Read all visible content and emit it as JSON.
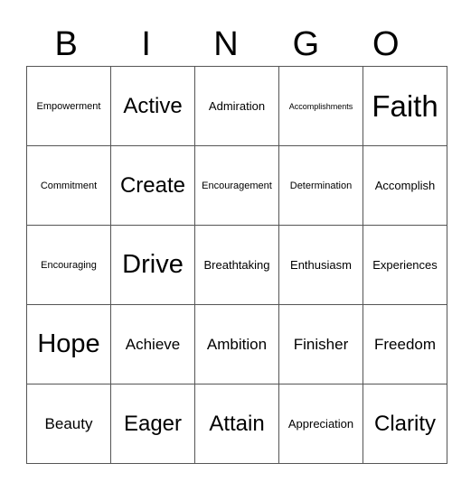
{
  "header": [
    "B",
    "I",
    "N",
    "G",
    "O"
  ],
  "rows": [
    [
      {
        "text": "Empowerment",
        "size": "s-sm"
      },
      {
        "text": "Active",
        "size": "s-xl"
      },
      {
        "text": "Admiration",
        "size": "s-md"
      },
      {
        "text": "Accomplishments",
        "size": "s-xs"
      },
      {
        "text": "Faith",
        "size": "s-max"
      }
    ],
    [
      {
        "text": "Commitment",
        "size": "s-sm"
      },
      {
        "text": "Create",
        "size": "s-xl"
      },
      {
        "text": "Encouragement",
        "size": "s-sm"
      },
      {
        "text": "Determination",
        "size": "s-sm"
      },
      {
        "text": "Accomplish",
        "size": "s-md"
      }
    ],
    [
      {
        "text": "Encouraging",
        "size": "s-sm"
      },
      {
        "text": "Drive",
        "size": "s-xxl"
      },
      {
        "text": "Breathtaking",
        "size": "s-md"
      },
      {
        "text": "Enthusiasm",
        "size": "s-md"
      },
      {
        "text": "Experiences",
        "size": "s-md"
      }
    ],
    [
      {
        "text": "Hope",
        "size": "s-xxl"
      },
      {
        "text": "Achieve",
        "size": "s-lg"
      },
      {
        "text": "Ambition",
        "size": "s-lg"
      },
      {
        "text": "Finisher",
        "size": "s-lg"
      },
      {
        "text": "Freedom",
        "size": "s-lg"
      }
    ],
    [
      {
        "text": "Beauty",
        "size": "s-lg"
      },
      {
        "text": "Eager",
        "size": "s-xl"
      },
      {
        "text": "Attain",
        "size": "s-xl"
      },
      {
        "text": "Appreciation",
        "size": "s-md"
      },
      {
        "text": "Clarity",
        "size": "s-xl"
      }
    ]
  ]
}
